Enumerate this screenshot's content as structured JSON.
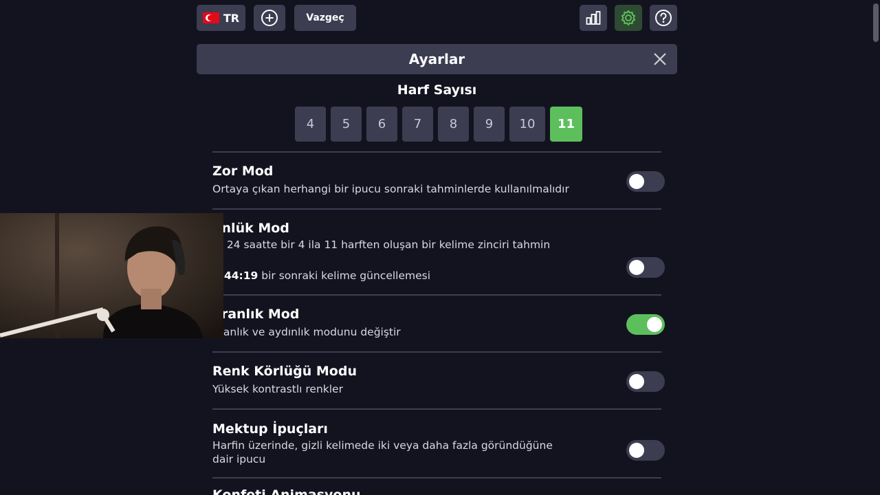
{
  "topbar": {
    "language": "TR",
    "cancel_label": "Vazgeç"
  },
  "settings": {
    "title": "Ayarlar",
    "letter_count": {
      "title": "Harf Sayısı",
      "options": [
        "4",
        "5",
        "6",
        "7",
        "8",
        "9",
        "10",
        "11"
      ],
      "selected": "11"
    },
    "hard_mode": {
      "title": "Zor Mod",
      "description": "Ortaya çıkan herhangi bir ipucu sonraki tahminlerde kullanılmalıdır",
      "enabled": false
    },
    "daily_mode": {
      "title": "ünlük Mod",
      "description": "er 24 saatte bir 4 ila 11 harften oluşan bir kelime zinciri tahmin\nin",
      "timer": "0:44:19",
      "timer_suffix": "bir sonraki kelime güncellemesi",
      "enabled": false
    },
    "dark_mode": {
      "title": "aranlık Mod",
      "description": "aranlık ve aydınlık modunu değiştir",
      "enabled": true
    },
    "color_blind_mode": {
      "title": "Renk Körlüğü Modu",
      "description": "Yüksek kontrastlı renkler",
      "enabled": false
    },
    "letter_hints": {
      "title": "Mektup İpuçları",
      "description": "Harfin üzerinde, gizli kelimede iki veya daha fazla göründüğüne dair ipucu",
      "enabled": false
    },
    "confetti": {
      "title": "Konfeti Animasyonu"
    }
  },
  "colors": {
    "background": "#131320",
    "panel": "#3c3d51",
    "accent_green": "#5cbf5c",
    "gear_active": "#2f4a32"
  }
}
